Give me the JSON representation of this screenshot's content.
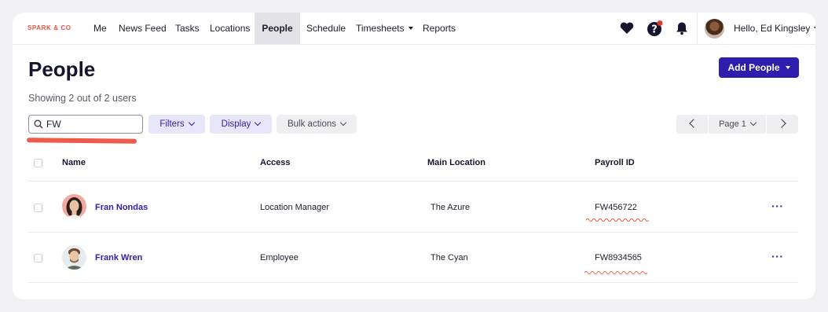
{
  "brand": {
    "logo": "SPARK & CO"
  },
  "nav": {
    "items": [
      {
        "label": "Me"
      },
      {
        "label": "News Feed"
      },
      {
        "label": "Tasks"
      },
      {
        "label": "Locations"
      },
      {
        "label": "People",
        "active": true
      },
      {
        "label": "Schedule"
      },
      {
        "label": "Timesheets",
        "has_dropdown": true
      },
      {
        "label": "Reports"
      }
    ],
    "icons": [
      "heart-icon",
      "help-icon",
      "bell-icon"
    ],
    "greeting": "Hello, Ed Kingsley"
  },
  "header": {
    "title": "People",
    "add_button": "Add People",
    "showing": "Showing 2 out of 2 users"
  },
  "toolbar": {
    "search_value": "FW",
    "filters": "Filters",
    "display": "Display",
    "bulk_actions": "Bulk actions",
    "page": "Page 1"
  },
  "table": {
    "columns": [
      "Name",
      "Access",
      "Main Location",
      "Payroll ID"
    ],
    "rows": [
      {
        "name": "Fran Nondas",
        "access": "Location Manager",
        "location": "The Azure",
        "payroll_id": "FW456722"
      },
      {
        "name": "Frank Wren",
        "access": "Employee",
        "location": "The Cyan",
        "payroll_id": "FW8934565"
      }
    ],
    "row_action": "···"
  },
  "colors": {
    "accent": "#2e1eae",
    "brand": "#e8543f",
    "annotation": "#ef5a4b",
    "notification": "#e0382c"
  }
}
